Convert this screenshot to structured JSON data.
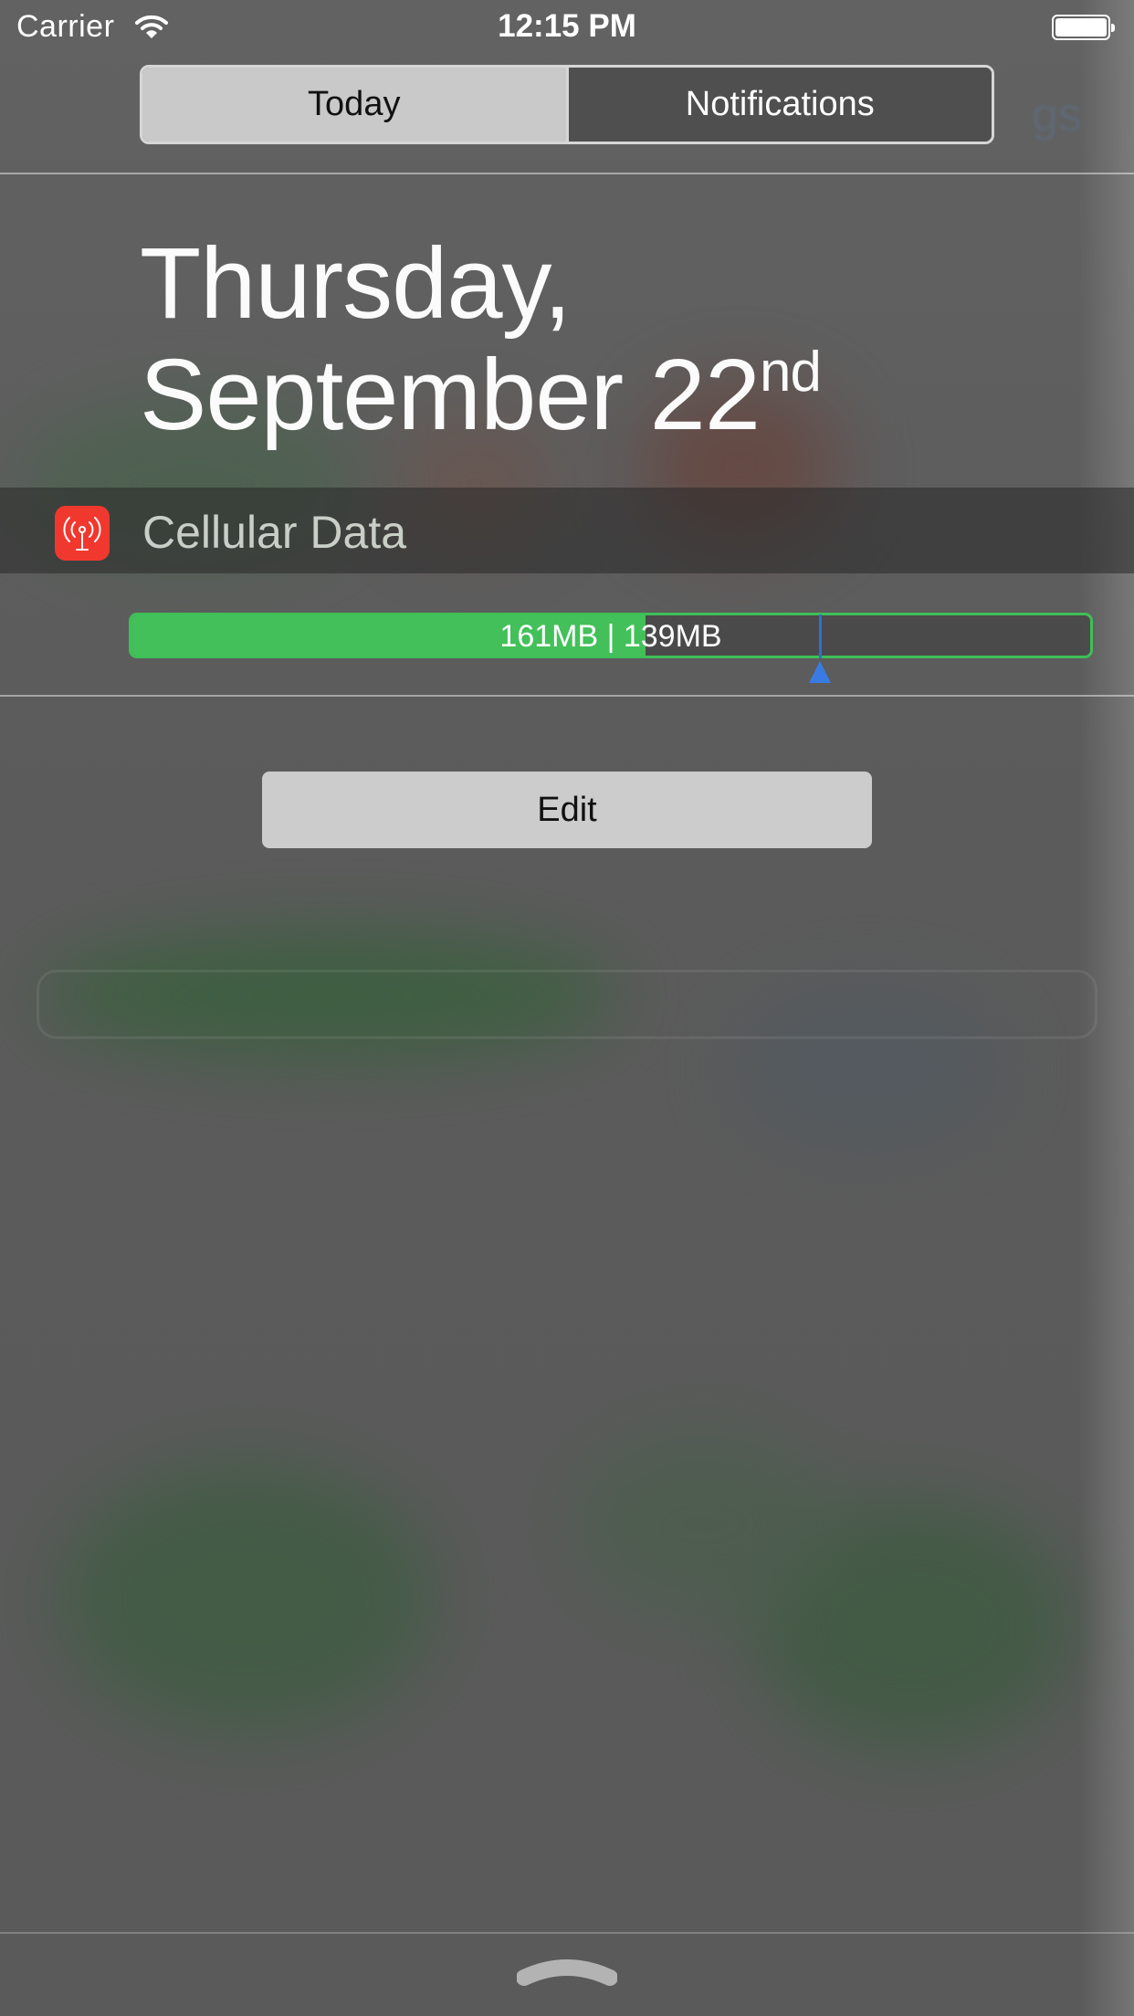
{
  "status_bar": {
    "carrier": "Carrier",
    "time": "12:15 PM",
    "wifi_icon": "wifi-icon",
    "battery_icon": "battery-icon"
  },
  "segmented_control": {
    "tabs": [
      {
        "label": "Today",
        "selected": true
      },
      {
        "label": "Notifications",
        "selected": false
      }
    ]
  },
  "date": {
    "line1": "Thursday,",
    "line2": "September 22",
    "suffix": "nd"
  },
  "widget": {
    "title": "Cellular Data",
    "icon": "antenna-icon",
    "icon_color": "#f1382e",
    "usage": {
      "label": "161MB | 139MB",
      "used_fraction": 0.536,
      "marker_fraction": 0.717,
      "bar_color": "#43c05a",
      "marker_color": "#3a7be3"
    }
  },
  "edit_button": {
    "label": "Edit"
  },
  "bottom": {
    "grabber_icon": "chevron-up-icon"
  }
}
